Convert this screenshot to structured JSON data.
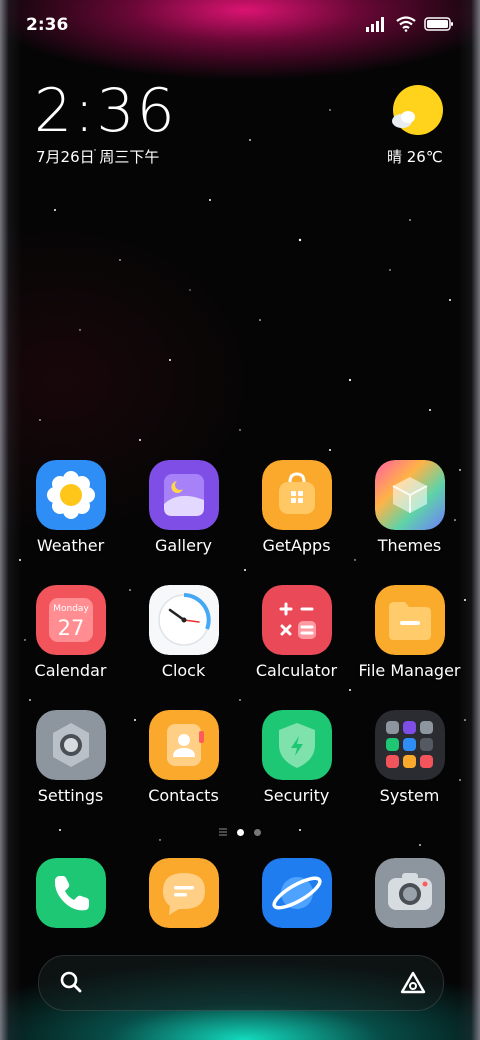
{
  "status_bar": {
    "time": "2:36"
  },
  "clock_widget": {
    "time": "2:36",
    "date": "7月26日 周三下午"
  },
  "weather_widget": {
    "text": "晴 26℃",
    "icon": "sun-cloud-icon"
  },
  "apps": [
    [
      {
        "label": "Weather",
        "icon": "weather-icon"
      },
      {
        "label": "Gallery",
        "icon": "gallery-icon"
      },
      {
        "label": "GetApps",
        "icon": "getapps-icon"
      },
      {
        "label": "Themes",
        "icon": "themes-icon"
      }
    ],
    [
      {
        "label": "Calendar",
        "icon": "calendar-icon",
        "sub": "Monday",
        "day": "27"
      },
      {
        "label": "Clock",
        "icon": "clock-icon"
      },
      {
        "label": "Calculator",
        "icon": "calculator-icon"
      },
      {
        "label": "File Manager",
        "icon": "file-manager-icon"
      }
    ],
    [
      {
        "label": "Settings",
        "icon": "settings-icon"
      },
      {
        "label": "Contacts",
        "icon": "contacts-icon"
      },
      {
        "label": "Security",
        "icon": "security-icon"
      },
      {
        "label": "System",
        "icon": "system-folder-icon"
      }
    ]
  ],
  "dock": [
    {
      "icon": "phone-icon"
    },
    {
      "icon": "messages-icon"
    },
    {
      "icon": "browser-icon"
    },
    {
      "icon": "camera-icon"
    }
  ],
  "page_indicator": {
    "pages": 2,
    "current": 1
  },
  "search_bar": {
    "left_icon": "search-icon",
    "right_icon": "assistant-icon"
  }
}
